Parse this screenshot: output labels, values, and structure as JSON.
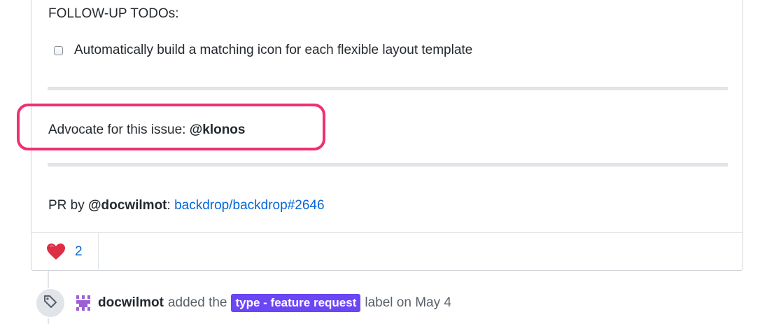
{
  "comment": {
    "heading": "FOLLOW-UP TODOs:",
    "todo_item": "Automatically build a matching icon for each flexible layout template",
    "advocate_prefix": "Advocate for this issue: ",
    "advocate_mention": "@klonos",
    "pr_prefix": "PR by ",
    "pr_mention": "@docwilmot",
    "pr_separator": ": ",
    "pr_link": "backdrop/backdrop#2646",
    "highlight_color": "#f0306e"
  },
  "reactions": {
    "heart_icon": "heart-icon",
    "count": "2"
  },
  "timeline_event": {
    "icon": "tag-icon",
    "user": "docwilmot",
    "action": "added the",
    "label": "type - feature request",
    "label_color": "#6b46f5",
    "suffix": "label on May 4"
  }
}
